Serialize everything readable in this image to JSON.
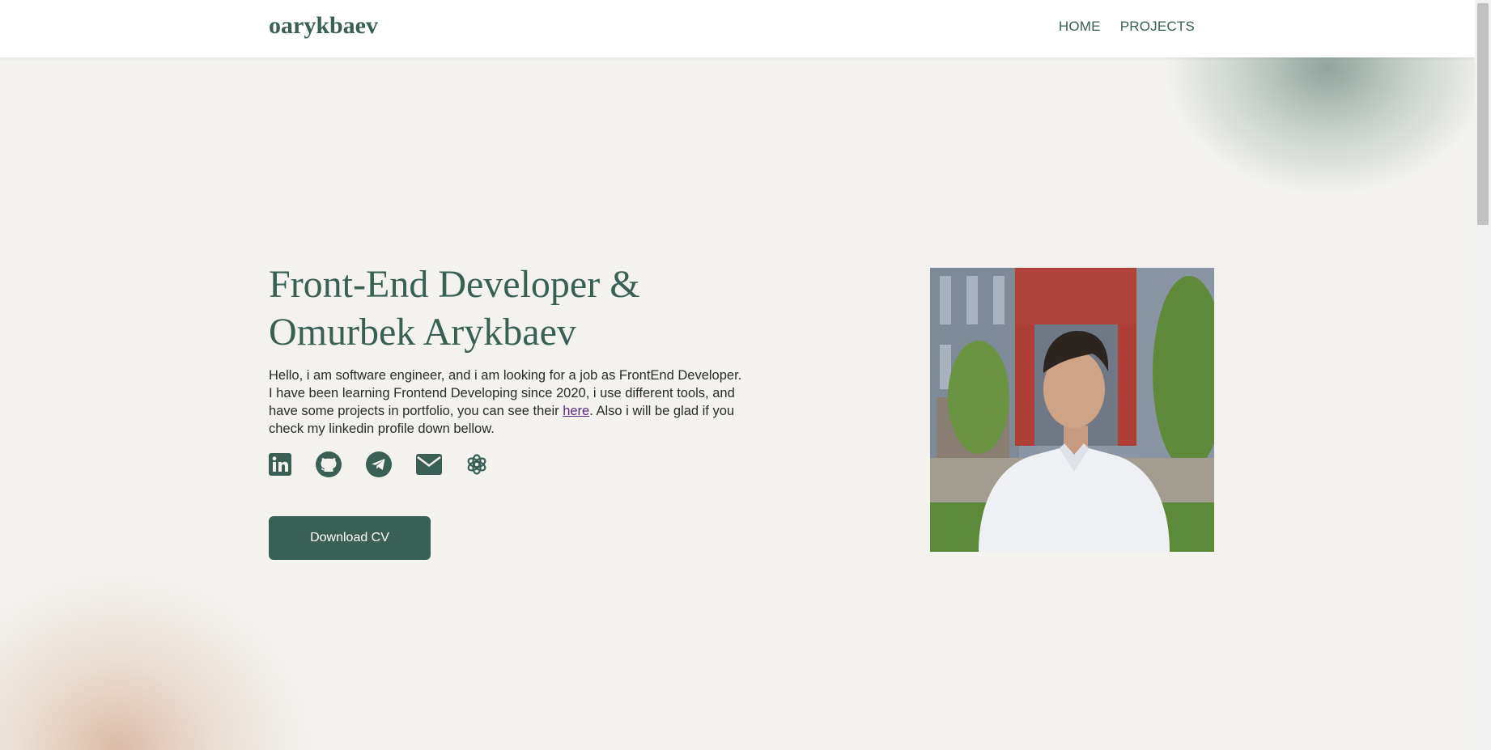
{
  "header": {
    "logo": "oarykbaev",
    "nav": [
      {
        "label": "HOME"
      },
      {
        "label": "PROJECTS"
      }
    ]
  },
  "hero": {
    "title_line1": "Front-End Developer &",
    "title_line2": "Omurbek Arykbaev",
    "text_part1": "Hello, i am software engineer, and i am looking for a job as FrontEnd Developer. I have been learning Frontend Developing since 2020, i use different tools, and have some projects in portfolio, you can see their ",
    "link_label": "here",
    "text_part2": ". Also i will be glad if you check my linkedin profile down bellow.",
    "download_button": "Download CV"
  },
  "socials": [
    {
      "icon": "linkedin-icon"
    },
    {
      "icon": "github-icon"
    },
    {
      "icon": "telegram-icon"
    },
    {
      "icon": "envelope-icon"
    },
    {
      "icon": "openai-icon"
    }
  ],
  "colors": {
    "accent": "#3a5f55",
    "background": "#f3f2ef",
    "link": "#5b2a86"
  }
}
